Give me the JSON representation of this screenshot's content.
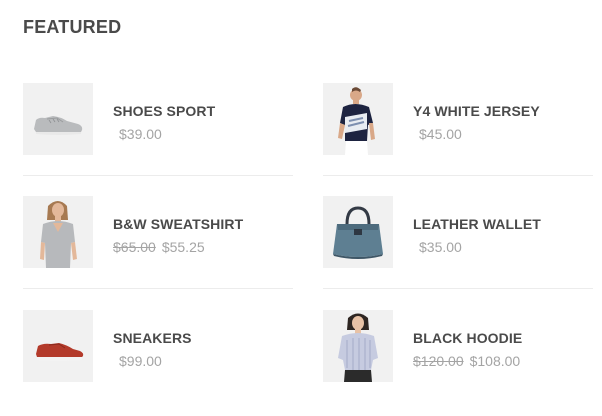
{
  "section": {
    "title": "FEATURED"
  },
  "products": [
    {
      "name": "SHOES SPORT",
      "price": "$39.00",
      "old_price": "",
      "image": "gray-sneaker-image"
    },
    {
      "name": "Y4 WHITE JERSEY",
      "price": "$45.00",
      "old_price": "",
      "image": "man-in-jersey-image"
    },
    {
      "name": "B&W SWEATSHIRT",
      "price": "$55.25",
      "old_price": "$65.00",
      "image": "woman-in-gray-top-image"
    },
    {
      "name": "LEATHER WALLET",
      "price": "$35.00",
      "old_price": "",
      "image": "blue-tote-bag-image"
    },
    {
      "name": "SNEAKERS",
      "price": "$99.00",
      "old_price": "",
      "image": "red-sneaker-image"
    },
    {
      "name": "BLACK HOODIE",
      "price": "$108.00",
      "old_price": "$120.00",
      "image": "woman-in-striped-shirt-image"
    }
  ],
  "colors": {
    "title": "#4a4a4a",
    "price": "#a4a4a4",
    "thumb_bg": "#f1f1f1",
    "divider": "#ececec"
  }
}
